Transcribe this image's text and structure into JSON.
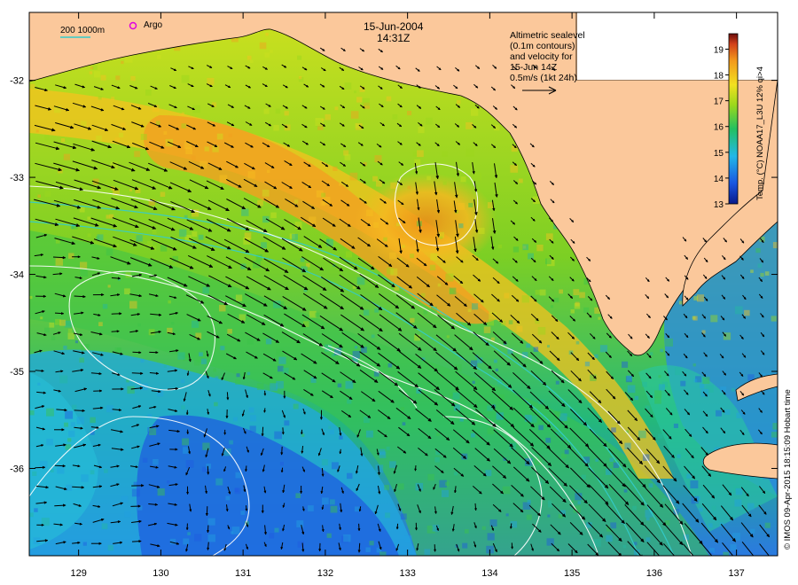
{
  "map": {
    "date": "15-Jun-2004",
    "time": "14:31Z",
    "legend_sealevel_lines": [
      "Altimetric sealevel",
      "(0.1m contours)",
      "and velocity for",
      "15-Jun 14Z",
      "0.5m/s (1kt 24h)"
    ],
    "scale_legend": "200  1000m",
    "argo_label": "Argo",
    "credit": "© IMOS 09-Apr-2015 18:15:09 Hobart time",
    "colorbar": {
      "label": "Temp. (°C) NOAA17_L3U 12% qi>4",
      "ticks": [
        "19",
        "18",
        "17",
        "16",
        "15",
        "14",
        "13"
      ],
      "min": 13,
      "max": 19.6
    },
    "axes": {
      "x_ticks": [
        "129",
        "130",
        "131",
        "132",
        "133",
        "134",
        "135",
        "136",
        "137"
      ],
      "y_ticks": [
        "-32",
        "-33",
        "-34",
        "-35",
        "-36"
      ],
      "lon_range": [
        128.4,
        137.5
      ],
      "lat_range": [
        -36.9,
        -31.3
      ]
    },
    "colors": {
      "land": "#fbc89b",
      "cold": "#1a3bd8",
      "warm": "#f08a18",
      "contour": "#ffffff",
      "isobath": "#33cccc",
      "argo": "#e000e0"
    }
  }
}
